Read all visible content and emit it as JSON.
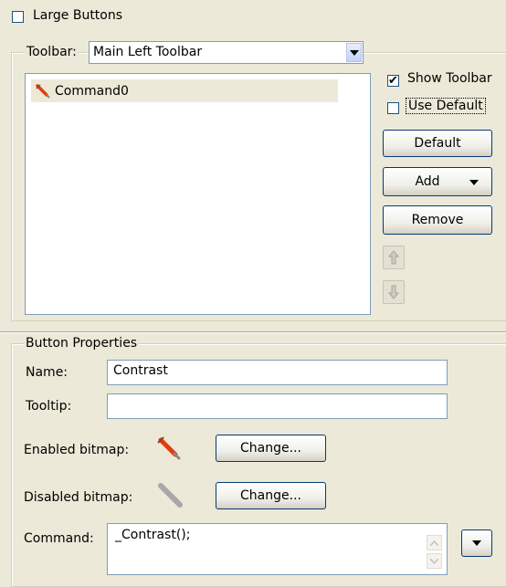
{
  "large_buttons": {
    "label": "Large Buttons",
    "checked": false
  },
  "toolbar_group": {
    "label": "Toolbar:",
    "selected": "Main Left Toolbar",
    "items": [
      {
        "label": "Command0"
      }
    ],
    "show_toolbar": {
      "label": "Show Toolbar",
      "checked": true
    },
    "use_default": {
      "label": "Use Default",
      "checked": false
    },
    "default_button": "Default",
    "add_button": "Add",
    "remove_button": "Remove"
  },
  "button_properties": {
    "title": "Button Properties",
    "name_label": "Name:",
    "name_value": "Contrast",
    "tooltip_label": "Tooltip:",
    "tooltip_value": "",
    "enabled_label": "Enabled bitmap:",
    "disabled_label": "Disabled bitmap:",
    "change_label": "Change...",
    "command_label": "Command:",
    "command_value": "_Contrast();"
  },
  "colors": {
    "background": "#ECE9D8",
    "border": "#7F9DB9",
    "brush_icon": "#E23C0E"
  },
  "icons": {
    "brush": "brush-icon",
    "brush_disabled": "brush-disabled-icon",
    "up": "arrow-up-icon",
    "down": "arrow-down-icon"
  }
}
